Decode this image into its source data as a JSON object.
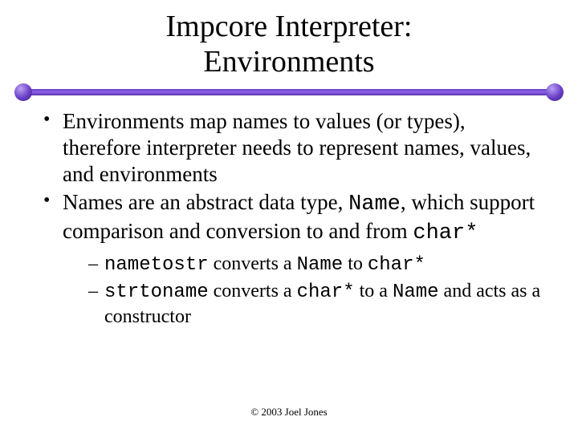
{
  "title_line1": "Impcore Interpreter:",
  "title_line2": "Environments",
  "bullets": {
    "b1": "Environments map names to values (or types), therefore interpreter needs to represent names, values, and environments",
    "b2_pre": "Names are an abstract data type, ",
    "b2_code": "Name",
    "b2_mid": ", which support comparison and conversion to and from ",
    "b2_code2": "char*",
    "s1_code1": "nametostr",
    "s1_mid": " converts a ",
    "s1_code2": "Name",
    "s1_mid2": " to ",
    "s1_code3": "char*",
    "s2_code1": "strtoname",
    "s2_mid": " converts a ",
    "s2_code2": "char*",
    "s2_mid2": " to a ",
    "s2_code3": "Name",
    "s2_tail": " and acts as a constructor"
  },
  "footer": "© 2003 Joel Jones"
}
